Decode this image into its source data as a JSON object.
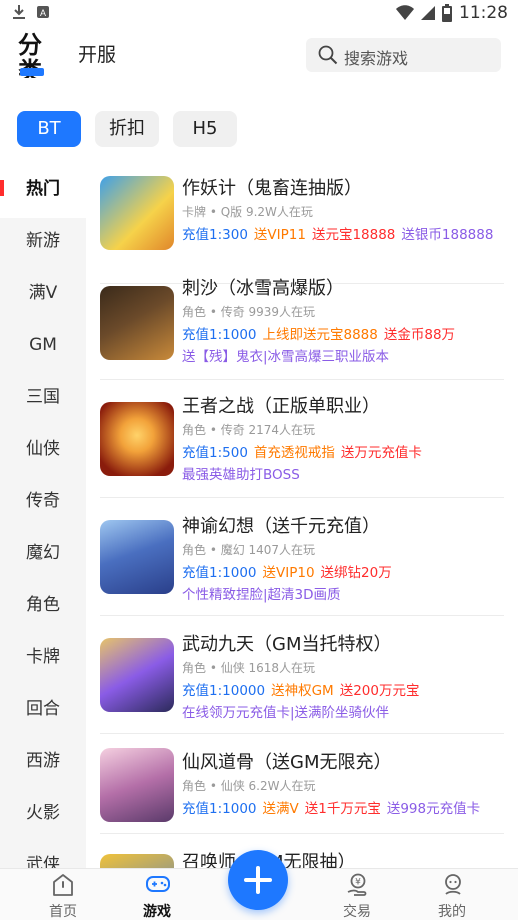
{
  "status_bar": {
    "time": "11:28"
  },
  "header": {
    "tab_category": "分类",
    "tab_kaifu": "开服",
    "search_placeholder": "搜索游戏"
  },
  "filters": [
    {
      "label": "BT",
      "active": true
    },
    {
      "label": "折扣",
      "active": false
    },
    {
      "label": "H5",
      "active": false
    }
  ],
  "sidebar": {
    "items": [
      "热门",
      "新游",
      "满V",
      "GM",
      "三国",
      "仙侠",
      "传奇",
      "魔幻",
      "角色",
      "卡牌",
      "回合",
      "西游",
      "火影",
      "武侠"
    ],
    "active_index": 0
  },
  "games": [
    {
      "title": "作妖计（鬼畜连抽版）",
      "meta": "卡牌 • Q版   9.2W人在玩",
      "tags": [
        {
          "text": "充值1:300",
          "color": "blue"
        },
        {
          "text": "送VIP11",
          "color": "orange"
        },
        {
          "text": "送元宝18888",
          "color": "red"
        },
        {
          "text": "送银币188888",
          "color": "purple"
        }
      ],
      "extra": "",
      "icon_colors": [
        "#3fa0e8",
        "#f6d24a"
      ]
    },
    {
      "title": "刺沙（冰雪高爆版）",
      "meta": "角色 • 传奇   9939人在玩",
      "tags": [
        {
          "text": "充值1:1000",
          "color": "blue"
        },
        {
          "text": "上线即送元宝8888",
          "color": "orange"
        },
        {
          "text": "送金币88万",
          "color": "red"
        }
      ],
      "extra": "送【残】鬼衣|冰雪高爆三职业版本",
      "icon_colors": [
        "#6b4a2a",
        "#c98a3a"
      ]
    },
    {
      "title": "王者之战（正版单职业）",
      "meta": "角色 • 传奇   2174人在玩",
      "tags": [
        {
          "text": "充值1:500",
          "color": "blue"
        },
        {
          "text": "首充透视戒指",
          "color": "orange"
        },
        {
          "text": "送万元充值卡",
          "color": "red"
        }
      ],
      "extra": "最强英雄助打BOSS",
      "icon_colors": [
        "#8a1c0c",
        "#f2a23a"
      ]
    },
    {
      "title": "神谕幻想（送千元充值）",
      "meta": "角色 • 魔幻   1407人在玩",
      "tags": [
        {
          "text": "充值1:1000",
          "color": "blue"
        },
        {
          "text": "送VIP10",
          "color": "orange"
        },
        {
          "text": "送绑钻20万",
          "color": "red"
        }
      ],
      "extra": "个性精致捏脸|超清3D画质",
      "icon_colors": [
        "#2a3f8a",
        "#9fc7f0"
      ]
    },
    {
      "title": "武动九天（GM当托特权）",
      "meta": "角色 • 仙侠   1618人在玩",
      "tags": [
        {
          "text": "充值1:10000",
          "color": "blue"
        },
        {
          "text": "送神权GM",
          "color": "orange"
        },
        {
          "text": "送200万元宝",
          "color": "red"
        }
      ],
      "extra": "在线领万元充值卡|送满阶坐骑伙伴",
      "icon_colors": [
        "#2b2a5a",
        "#e7c46a"
      ]
    },
    {
      "title": "仙风道骨（送GM无限充）",
      "meta": "角色 • 仙侠   6.2W人在玩",
      "tags": [
        {
          "text": "充值1:1000",
          "color": "blue"
        },
        {
          "text": "送满V",
          "color": "orange"
        },
        {
          "text": "送1千万元宝",
          "color": "red"
        },
        {
          "text": "送998元充值卡",
          "color": "purple"
        }
      ],
      "extra": "",
      "icon_colors": [
        "#b46fa8",
        "#f5d0e0"
      ]
    },
    {
      "title": "召唤师（GM无限抽）",
      "meta": "",
      "tags": [],
      "extra": "",
      "icon_colors": [
        "#f0c23a",
        "#3a6fd0"
      ]
    }
  ],
  "bottom_nav": {
    "items": [
      {
        "label": "首页",
        "icon": "home-icon",
        "active": false
      },
      {
        "label": "游戏",
        "icon": "gamepad-icon",
        "active": true
      },
      {
        "label": "交易",
        "icon": "trade-icon",
        "active": false
      },
      {
        "label": "我的",
        "icon": "profile-icon",
        "active": false
      }
    ],
    "fab_icon": "plus-icon"
  },
  "colors": {
    "accent": "#1e78ff",
    "sidebar_marker": "#ff2d2d",
    "tag_blue": "#1e6ff0",
    "tag_orange": "#ff7a00",
    "tag_red": "#ff2d2d",
    "tag_purple": "#8a5ce6"
  }
}
